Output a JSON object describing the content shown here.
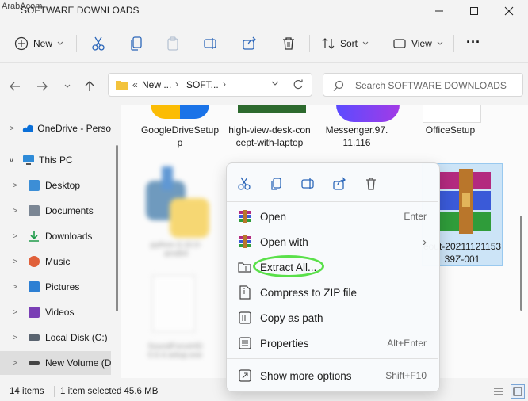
{
  "watermark": "ArabAcom",
  "window": {
    "title": "SOFTWARE DOWNLOADS"
  },
  "toolbar": {
    "new_label": "New",
    "sort_label": "Sort",
    "view_label": "View",
    "more_label": "···"
  },
  "address": {
    "prefix": "«",
    "crumb1": "New ...",
    "crumb2": "SOFT...",
    "search_placeholder": "Search SOFTWARE DOWNLOADS"
  },
  "sidebar": {
    "items": [
      {
        "label": "OneDrive - Perso",
        "color": "#0a6fd8"
      },
      {
        "label": "This PC",
        "color": "#2e8bd8"
      },
      {
        "label": "Desktop",
        "color": "#3c8ed6"
      },
      {
        "label": "Documents",
        "color": "#7b8694"
      },
      {
        "label": "Downloads",
        "color": "#1f9b4a"
      },
      {
        "label": "Music",
        "color": "#e0603a"
      },
      {
        "label": "Pictures",
        "color": "#2d7fd3"
      },
      {
        "label": "Videos",
        "color": "#7a3fb5"
      },
      {
        "label": "Local Disk (C:)",
        "color": "#5a6470"
      },
      {
        "label": "New Volume (D",
        "color": "#444444"
      }
    ]
  },
  "files": {
    "google": "GoogleDriveSetup",
    "desk": "high-view-desk-concept-with-laptop",
    "messenger": "Messenger.97.11.116",
    "office": "OfficeSetup",
    "rar": "eout-2021112115339Z-001"
  },
  "context_menu": {
    "items": [
      {
        "label": "Open",
        "shortcut": "Enter"
      },
      {
        "label": "Open with",
        "shortcut": "›"
      },
      {
        "label": "Extract All...",
        "shortcut": ""
      },
      {
        "label": "Compress to ZIP file",
        "shortcut": ""
      },
      {
        "label": "Copy as path",
        "shortcut": ""
      },
      {
        "label": "Properties",
        "shortcut": "Alt+Enter"
      },
      {
        "label": "Show more options",
        "shortcut": "Shift+F10"
      }
    ]
  },
  "status": {
    "count": "14 items",
    "selected": "1 item selected 45.6 MB"
  },
  "colors": {
    "highlight": "#5ae04a",
    "selection": "#cce4f7",
    "accent": "#0a6fd8"
  }
}
